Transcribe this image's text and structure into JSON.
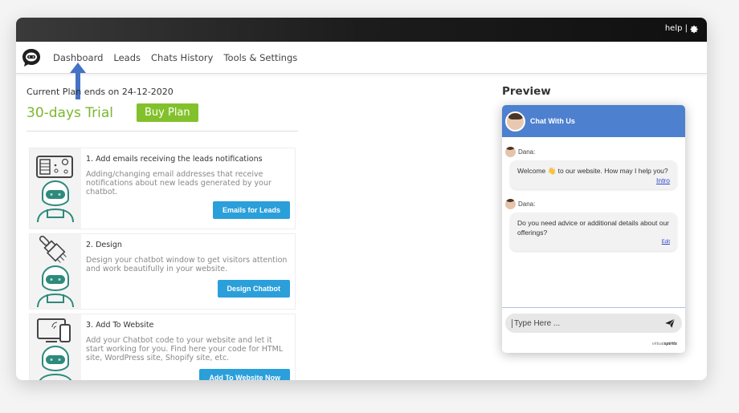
{
  "topbar": {
    "help_label": "help |",
    "settings_icon": "gear-icon"
  },
  "nav": {
    "logo_icon": "chatbot-logo-icon",
    "items": [
      {
        "label": "Dashboard"
      },
      {
        "label": "Leads"
      },
      {
        "label": "Chats History"
      },
      {
        "label": "Tools & Settings"
      }
    ]
  },
  "annotation": {
    "icon": "arrow-up-icon",
    "color": "#4472c4"
  },
  "plan": {
    "ends_text": "Current Plan ends on 24-12-2020",
    "trial_label": "30-days Trial",
    "buy_label": "Buy Plan"
  },
  "steps": [
    {
      "title": "1. Add emails receiving the leads notifications",
      "description": "Adding/changing email addresses that receive notifications about new leads generated by your chatbot.",
      "button": "Emails for Leads",
      "icon": "email-board-robot-icon"
    },
    {
      "title": "2. Design",
      "description": "Design your chatbot window to get visitors attention and work beautifully in your website.",
      "button": "Design Chatbot",
      "icon": "paintbrush-robot-icon"
    },
    {
      "title": "3. Add To Website",
      "description": "Add your Chatbot code to your website and let it start working for you. Find here your code for HTML site, WordPress site, Shopify site, etc.",
      "button": "Add To Website Now",
      "icon": "devices-robot-icon"
    }
  ],
  "preview": {
    "title": "Preview",
    "chat": {
      "header_title": "Chat With Us",
      "messages": [
        {
          "sender": "Dana:",
          "text_before": "Welcome",
          "emoji": "👋",
          "text_after": " to our website. How may I help you?",
          "link": "Intro"
        },
        {
          "sender": "Dana:",
          "text": "Do you need advice or additional details about our offerings?",
          "link": "Edit"
        }
      ],
      "input_placeholder": "Type Here ...",
      "brand_light": "virtual",
      "brand_bold": "spirits"
    }
  },
  "colors": {
    "accent_green": "#83c12c",
    "button_blue": "#2b9fda",
    "chat_header": "#4d81cf",
    "robot_teal": "#2e8a7c"
  }
}
